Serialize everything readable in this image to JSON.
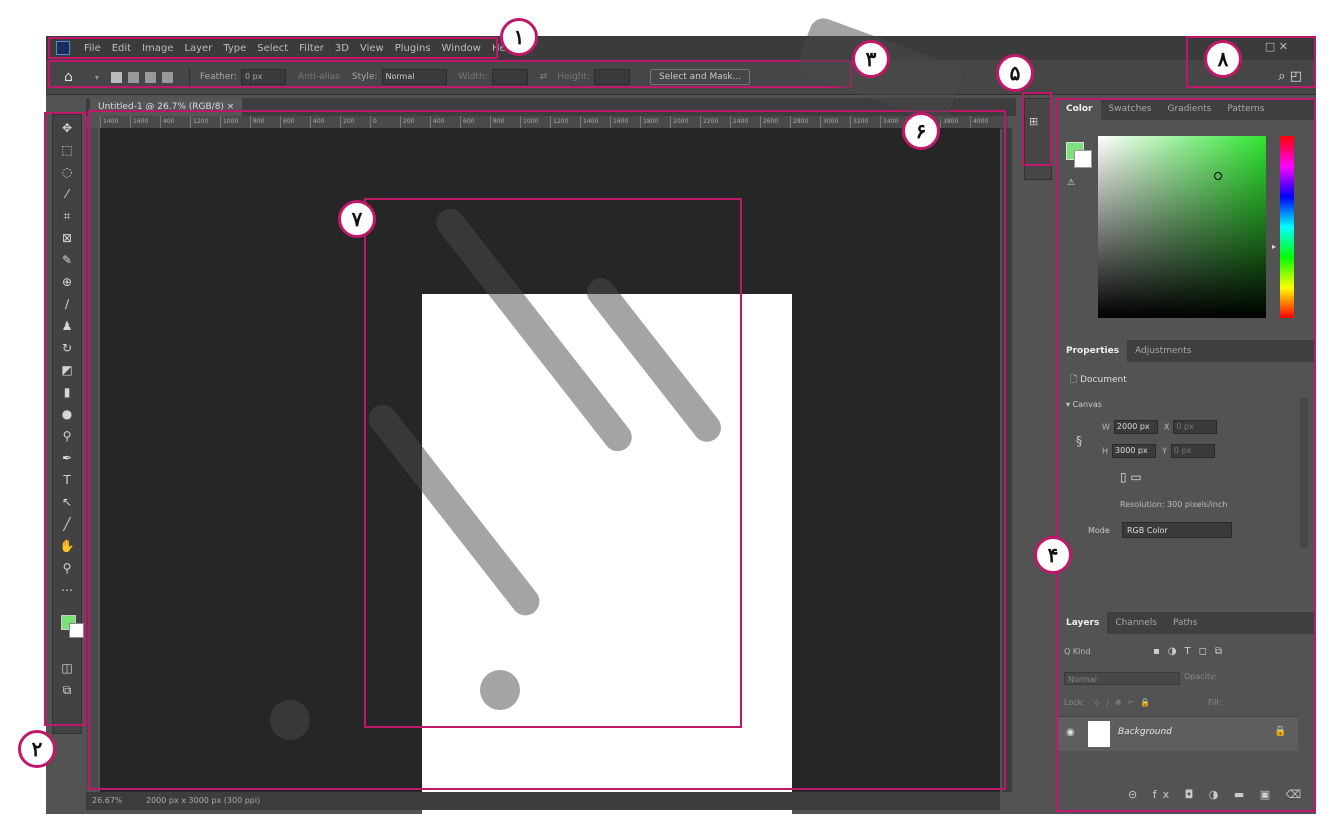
{
  "menubar": {
    "items": [
      "File",
      "Edit",
      "Image",
      "Layer",
      "Type",
      "Select",
      "Filter",
      "3D",
      "View",
      "Plugins",
      "Window",
      "Help"
    ],
    "window_controls": "□  ✕"
  },
  "options_bar": {
    "feather_label": "Feather:",
    "feather_value": "0 px",
    "antialias_label": "Anti-alias",
    "style_label": "Style:",
    "style_value": "Normal",
    "width_label": "Width:",
    "height_label": "Height:",
    "select_mask_button": "Select and Mask..."
  },
  "document": {
    "tab_title": "Untitled-1 @ 26.7% (RGB/8) ×",
    "ruler_ticks": [
      "1400",
      "1600",
      "400",
      "1200",
      "1000",
      "800",
      "600",
      "400",
      "200",
      "0",
      "200",
      "400",
      "600",
      "800",
      "1000",
      "1200",
      "1400",
      "1600",
      "1800",
      "2000",
      "2200",
      "2400",
      "2600",
      "2800",
      "3000",
      "3200",
      "3400",
      "3600",
      "3800",
      "4000"
    ],
    "zoom": "26.67%",
    "status_info": "2000 px x 3000 px (300 ppi)"
  },
  "color_panel": {
    "tabs": [
      "Color",
      "Swatches",
      "Gradients",
      "Patterns"
    ],
    "gamut_icon": "⚠",
    "foreground_color": "#7be27b",
    "background_color": "#ffffff"
  },
  "properties_panel": {
    "tabs": [
      "Properties",
      "Adjustments"
    ],
    "doc_label": "Document",
    "canvas_label": "Canvas",
    "w_label": "W",
    "w_value": "2000 px",
    "x_label": "X",
    "x_value": "0 px",
    "h_label": "H",
    "h_value": "3000 px",
    "y_label": "Y",
    "y_value": "0 px",
    "resolution": "Resolution: 300 pixels/inch",
    "mode_label": "Mode",
    "mode_value": "RGB Color"
  },
  "layers_panel": {
    "tabs": [
      "Layers",
      "Channels",
      "Paths"
    ],
    "filter_label": "Q Kind",
    "blend_value": "Normal",
    "opacity_label": "Opacity:",
    "lock_label": "Lock:",
    "fill_label": "Fill:",
    "layer_name": "Background"
  },
  "callouts": [
    "۱",
    "۲",
    "۳",
    "۴",
    "۵",
    "۶",
    "۷",
    "۸"
  ]
}
